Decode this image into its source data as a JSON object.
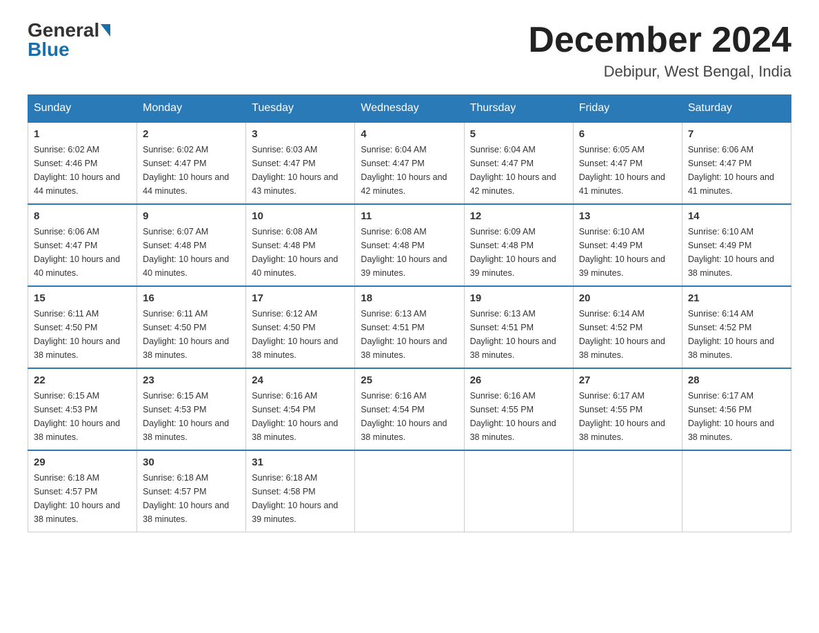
{
  "header": {
    "logo_general": "General",
    "logo_blue": "Blue",
    "month_title": "December 2024",
    "location": "Debipur, West Bengal, India"
  },
  "days_of_week": [
    "Sunday",
    "Monday",
    "Tuesday",
    "Wednesday",
    "Thursday",
    "Friday",
    "Saturday"
  ],
  "weeks": [
    [
      {
        "day": "1",
        "sunrise": "6:02 AM",
        "sunset": "4:46 PM",
        "daylight": "10 hours and 44 minutes."
      },
      {
        "day": "2",
        "sunrise": "6:02 AM",
        "sunset": "4:47 PM",
        "daylight": "10 hours and 44 minutes."
      },
      {
        "day": "3",
        "sunrise": "6:03 AM",
        "sunset": "4:47 PM",
        "daylight": "10 hours and 43 minutes."
      },
      {
        "day": "4",
        "sunrise": "6:04 AM",
        "sunset": "4:47 PM",
        "daylight": "10 hours and 42 minutes."
      },
      {
        "day": "5",
        "sunrise": "6:04 AM",
        "sunset": "4:47 PM",
        "daylight": "10 hours and 42 minutes."
      },
      {
        "day": "6",
        "sunrise": "6:05 AM",
        "sunset": "4:47 PM",
        "daylight": "10 hours and 41 minutes."
      },
      {
        "day": "7",
        "sunrise": "6:06 AM",
        "sunset": "4:47 PM",
        "daylight": "10 hours and 41 minutes."
      }
    ],
    [
      {
        "day": "8",
        "sunrise": "6:06 AM",
        "sunset": "4:47 PM",
        "daylight": "10 hours and 40 minutes."
      },
      {
        "day": "9",
        "sunrise": "6:07 AM",
        "sunset": "4:48 PM",
        "daylight": "10 hours and 40 minutes."
      },
      {
        "day": "10",
        "sunrise": "6:08 AM",
        "sunset": "4:48 PM",
        "daylight": "10 hours and 40 minutes."
      },
      {
        "day": "11",
        "sunrise": "6:08 AM",
        "sunset": "4:48 PM",
        "daylight": "10 hours and 39 minutes."
      },
      {
        "day": "12",
        "sunrise": "6:09 AM",
        "sunset": "4:48 PM",
        "daylight": "10 hours and 39 minutes."
      },
      {
        "day": "13",
        "sunrise": "6:10 AM",
        "sunset": "4:49 PM",
        "daylight": "10 hours and 39 minutes."
      },
      {
        "day": "14",
        "sunrise": "6:10 AM",
        "sunset": "4:49 PM",
        "daylight": "10 hours and 38 minutes."
      }
    ],
    [
      {
        "day": "15",
        "sunrise": "6:11 AM",
        "sunset": "4:50 PM",
        "daylight": "10 hours and 38 minutes."
      },
      {
        "day": "16",
        "sunrise": "6:11 AM",
        "sunset": "4:50 PM",
        "daylight": "10 hours and 38 minutes."
      },
      {
        "day": "17",
        "sunrise": "6:12 AM",
        "sunset": "4:50 PM",
        "daylight": "10 hours and 38 minutes."
      },
      {
        "day": "18",
        "sunrise": "6:13 AM",
        "sunset": "4:51 PM",
        "daylight": "10 hours and 38 minutes."
      },
      {
        "day": "19",
        "sunrise": "6:13 AM",
        "sunset": "4:51 PM",
        "daylight": "10 hours and 38 minutes."
      },
      {
        "day": "20",
        "sunrise": "6:14 AM",
        "sunset": "4:52 PM",
        "daylight": "10 hours and 38 minutes."
      },
      {
        "day": "21",
        "sunrise": "6:14 AM",
        "sunset": "4:52 PM",
        "daylight": "10 hours and 38 minutes."
      }
    ],
    [
      {
        "day": "22",
        "sunrise": "6:15 AM",
        "sunset": "4:53 PM",
        "daylight": "10 hours and 38 minutes."
      },
      {
        "day": "23",
        "sunrise": "6:15 AM",
        "sunset": "4:53 PM",
        "daylight": "10 hours and 38 minutes."
      },
      {
        "day": "24",
        "sunrise": "6:16 AM",
        "sunset": "4:54 PM",
        "daylight": "10 hours and 38 minutes."
      },
      {
        "day": "25",
        "sunrise": "6:16 AM",
        "sunset": "4:54 PM",
        "daylight": "10 hours and 38 minutes."
      },
      {
        "day": "26",
        "sunrise": "6:16 AM",
        "sunset": "4:55 PM",
        "daylight": "10 hours and 38 minutes."
      },
      {
        "day": "27",
        "sunrise": "6:17 AM",
        "sunset": "4:55 PM",
        "daylight": "10 hours and 38 minutes."
      },
      {
        "day": "28",
        "sunrise": "6:17 AM",
        "sunset": "4:56 PM",
        "daylight": "10 hours and 38 minutes."
      }
    ],
    [
      {
        "day": "29",
        "sunrise": "6:18 AM",
        "sunset": "4:57 PM",
        "daylight": "10 hours and 38 minutes."
      },
      {
        "day": "30",
        "sunrise": "6:18 AM",
        "sunset": "4:57 PM",
        "daylight": "10 hours and 38 minutes."
      },
      {
        "day": "31",
        "sunrise": "6:18 AM",
        "sunset": "4:58 PM",
        "daylight": "10 hours and 39 minutes."
      },
      null,
      null,
      null,
      null
    ]
  ]
}
